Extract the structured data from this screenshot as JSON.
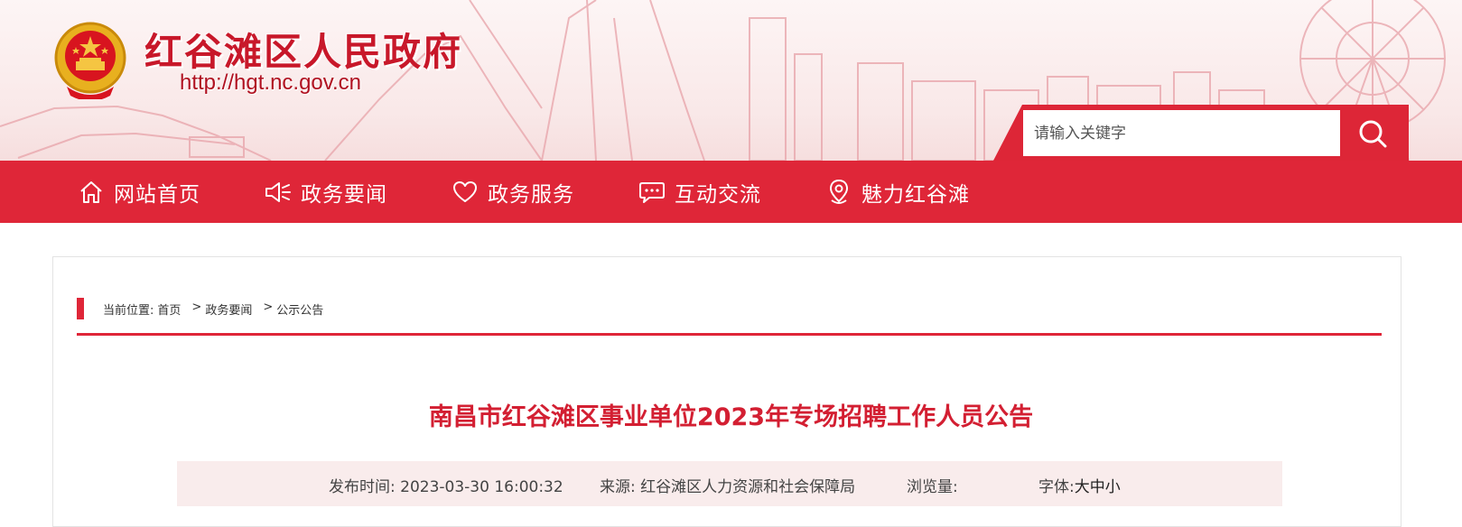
{
  "header": {
    "site_title": "红谷滩区人民政府",
    "site_url": "http://hgt.nc.gov.cn",
    "logo_icon": "national-emblem-icon",
    "brand_color": "#df2638",
    "search": {
      "placeholder": "请输入关键字",
      "value": "",
      "button_icon": "search-icon"
    }
  },
  "nav": {
    "items": [
      {
        "label": "网站首页",
        "icon": "home-icon"
      },
      {
        "label": "政务要闻",
        "icon": "megaphone-icon"
      },
      {
        "label": "政务服务",
        "icon": "heart-icon"
      },
      {
        "label": "互动交流",
        "icon": "chat-bubble-icon"
      },
      {
        "label": "魅力红谷滩",
        "icon": "location-pin-icon"
      }
    ]
  },
  "breadcrumb": {
    "prefix": "当前位置:",
    "items": [
      "首页",
      "政务要闻",
      "公示公告"
    ],
    "separator": ">"
  },
  "article": {
    "title": "南昌市红谷滩区事业单位2023年专场招聘工作人员公告",
    "meta": {
      "publish_label": "发布时间:",
      "publish_value": "2023-03-30 16:00:32",
      "source_label": "来源:",
      "source_value": "红谷滩区人力资源和社会保障局",
      "views_label": "浏览量:",
      "views_value": "",
      "font_label": "字体:",
      "font_sizes": [
        "大",
        "中",
        "小"
      ]
    }
  }
}
